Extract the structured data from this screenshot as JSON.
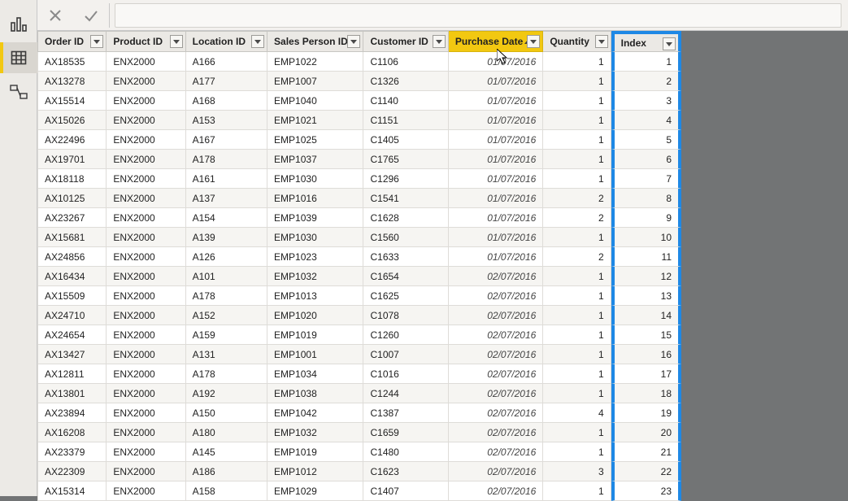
{
  "columns": [
    {
      "label": "Order ID",
      "align": "left",
      "sorted": false,
      "highlight": false
    },
    {
      "label": "Product ID",
      "align": "left",
      "sorted": false,
      "highlight": false
    },
    {
      "label": "Location ID",
      "align": "left",
      "sorted": false,
      "highlight": false
    },
    {
      "label": "Sales Person ID",
      "align": "left",
      "sorted": false,
      "highlight": false
    },
    {
      "label": "Customer ID",
      "align": "left",
      "sorted": false,
      "highlight": false
    },
    {
      "label": "Purchase Date",
      "align": "date",
      "sorted": true,
      "highlight": false
    },
    {
      "label": "Quantity",
      "align": "num",
      "sorted": false,
      "highlight": false
    },
    {
      "label": "Index",
      "align": "num",
      "sorted": false,
      "highlight": true
    }
  ],
  "rows": [
    [
      "AX18535",
      "ENX2000",
      "A166",
      "EMP1022",
      "C1106",
      "01/07/2016",
      "1",
      "1"
    ],
    [
      "AX13278",
      "ENX2000",
      "A177",
      "EMP1007",
      "C1326",
      "01/07/2016",
      "1",
      "2"
    ],
    [
      "AX15514",
      "ENX2000",
      "A168",
      "EMP1040",
      "C1140",
      "01/07/2016",
      "1",
      "3"
    ],
    [
      "AX15026",
      "ENX2000",
      "A153",
      "EMP1021",
      "C1151",
      "01/07/2016",
      "1",
      "4"
    ],
    [
      "AX22496",
      "ENX2000",
      "A167",
      "EMP1025",
      "C1405",
      "01/07/2016",
      "1",
      "5"
    ],
    [
      "AX19701",
      "ENX2000",
      "A178",
      "EMP1037",
      "C1765",
      "01/07/2016",
      "1",
      "6"
    ],
    [
      "AX18118",
      "ENX2000",
      "A161",
      "EMP1030",
      "C1296",
      "01/07/2016",
      "1",
      "7"
    ],
    [
      "AX10125",
      "ENX2000",
      "A137",
      "EMP1016",
      "C1541",
      "01/07/2016",
      "2",
      "8"
    ],
    [
      "AX23267",
      "ENX2000",
      "A154",
      "EMP1039",
      "C1628",
      "01/07/2016",
      "2",
      "9"
    ],
    [
      "AX15681",
      "ENX2000",
      "A139",
      "EMP1030",
      "C1560",
      "01/07/2016",
      "1",
      "10"
    ],
    [
      "AX24856",
      "ENX2000",
      "A126",
      "EMP1023",
      "C1633",
      "01/07/2016",
      "2",
      "11"
    ],
    [
      "AX16434",
      "ENX2000",
      "A101",
      "EMP1032",
      "C1654",
      "02/07/2016",
      "1",
      "12"
    ],
    [
      "AX15509",
      "ENX2000",
      "A178",
      "EMP1013",
      "C1625",
      "02/07/2016",
      "1",
      "13"
    ],
    [
      "AX24710",
      "ENX2000",
      "A152",
      "EMP1020",
      "C1078",
      "02/07/2016",
      "1",
      "14"
    ],
    [
      "AX24654",
      "ENX2000",
      "A159",
      "EMP1019",
      "C1260",
      "02/07/2016",
      "1",
      "15"
    ],
    [
      "AX13427",
      "ENX2000",
      "A131",
      "EMP1001",
      "C1007",
      "02/07/2016",
      "1",
      "16"
    ],
    [
      "AX12811",
      "ENX2000",
      "A178",
      "EMP1034",
      "C1016",
      "02/07/2016",
      "1",
      "17"
    ],
    [
      "AX13801",
      "ENX2000",
      "A192",
      "EMP1038",
      "C1244",
      "02/07/2016",
      "1",
      "18"
    ],
    [
      "AX23894",
      "ENX2000",
      "A150",
      "EMP1042",
      "C1387",
      "02/07/2016",
      "4",
      "19"
    ],
    [
      "AX16208",
      "ENX2000",
      "A180",
      "EMP1032",
      "C1659",
      "02/07/2016",
      "1",
      "20"
    ],
    [
      "AX23379",
      "ENX2000",
      "A145",
      "EMP1019",
      "C1480",
      "02/07/2016",
      "1",
      "21"
    ],
    [
      "AX22309",
      "ENX2000",
      "A186",
      "EMP1012",
      "C1623",
      "02/07/2016",
      "3",
      "22"
    ],
    [
      "AX15314",
      "ENX2000",
      "A158",
      "EMP1029",
      "C1407",
      "02/07/2016",
      "1",
      "23"
    ]
  ]
}
